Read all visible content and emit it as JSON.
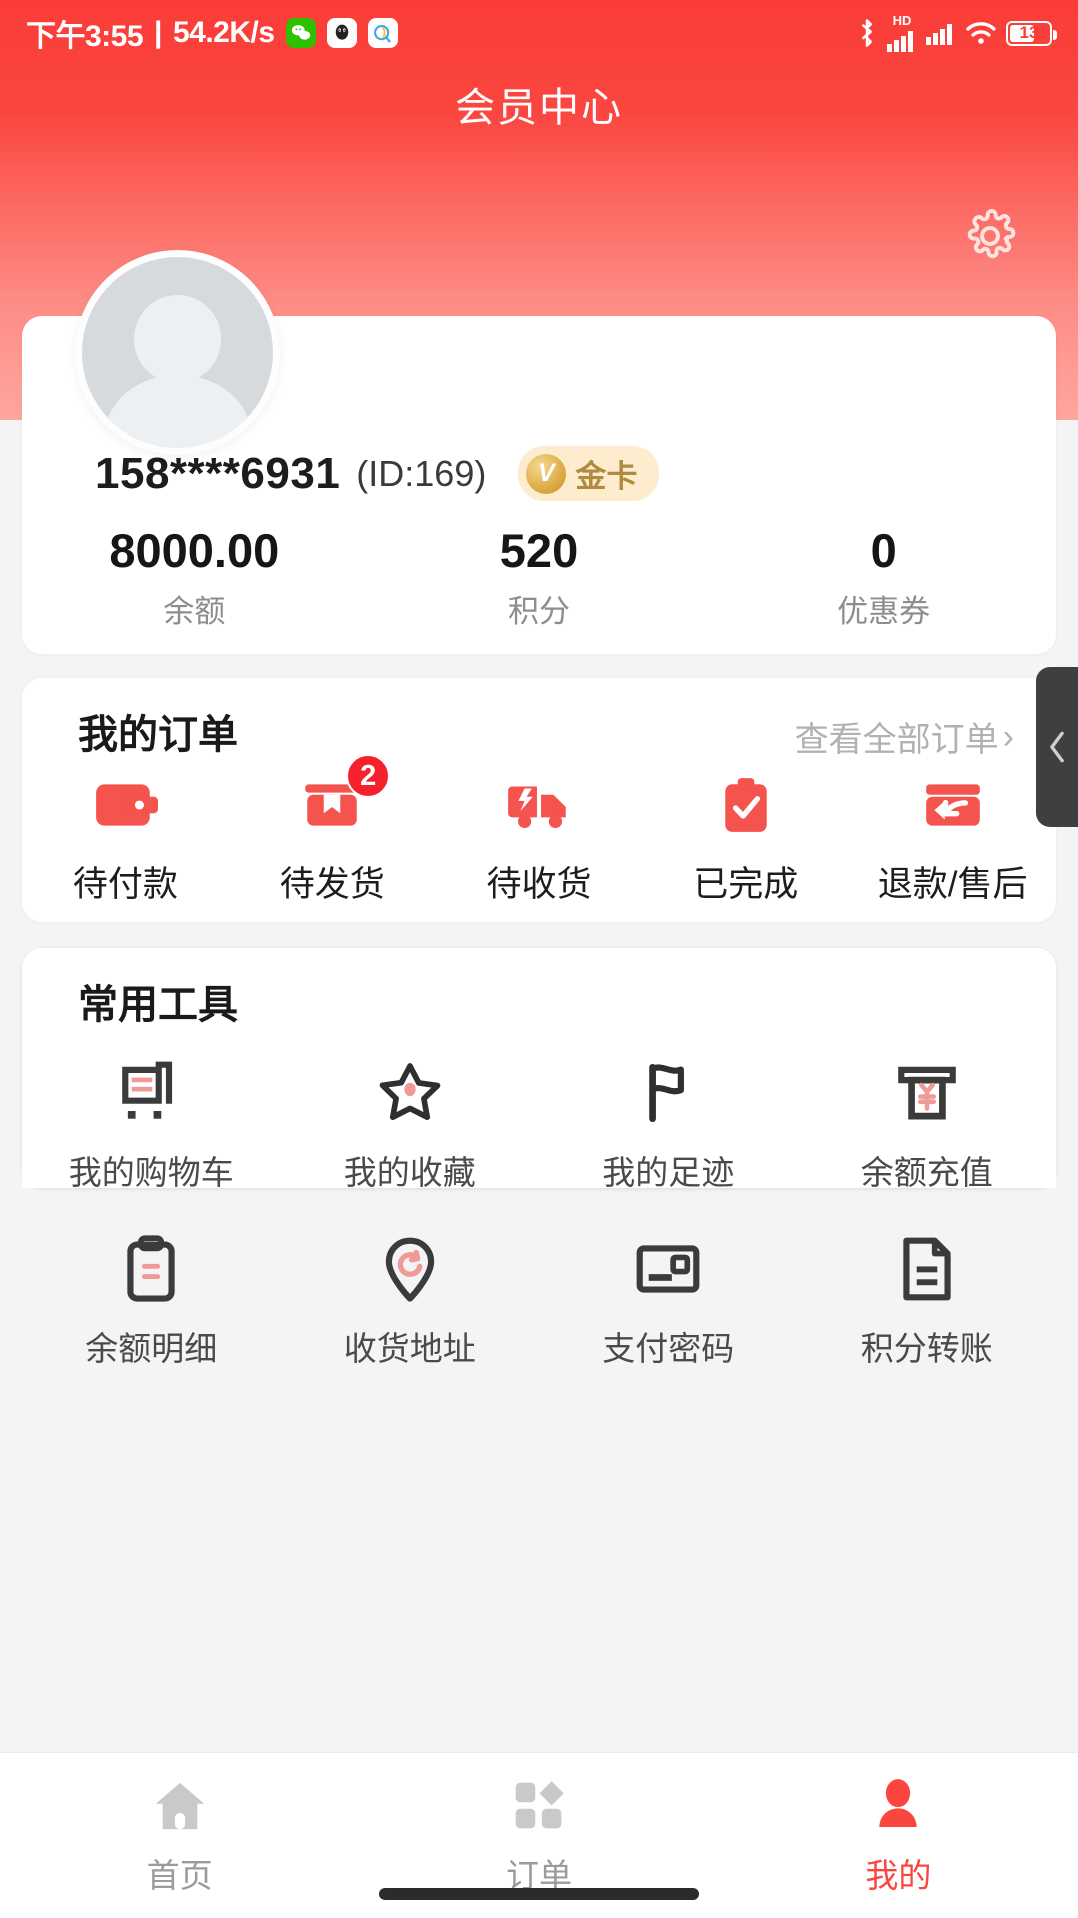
{
  "status_bar": {
    "time": "下午3:55",
    "separator": "|",
    "net_speed": "54.2K/s",
    "app_icons": [
      "wechat-icon",
      "qq-icon",
      "qq-browser-icon"
    ],
    "right_icons": [
      "bluetooth-icon",
      "hd-icon",
      "signal-1-icon",
      "signal-2-icon",
      "wifi-icon"
    ],
    "battery_level": "13",
    "hd_label": "HD"
  },
  "header": {
    "title": "会员中心",
    "settings_icon": "gear-icon",
    "bg_color": "#fb4640"
  },
  "profile": {
    "avatar_icon": "default-avatar-icon",
    "phone": "158****6931",
    "user_id": "(ID:169)",
    "vip": {
      "icon_text": "V",
      "label": "金卡",
      "bg": "#fdeccd",
      "text_color": "#b08a3e"
    },
    "stats": [
      {
        "value": "8000.00",
        "label": "余额"
      },
      {
        "value": "520",
        "label": "积分"
      },
      {
        "value": "0",
        "label": "优惠券"
      }
    ]
  },
  "orders": {
    "title": "我的订单",
    "view_all": "查看全部订单",
    "view_all_chevron": "›",
    "items": [
      {
        "label": "待付款",
        "icon": "wallet-icon",
        "badge": ""
      },
      {
        "label": "待发货",
        "icon": "package-box-icon",
        "badge": "2"
      },
      {
        "label": "待收货",
        "icon": "delivery-truck-icon",
        "badge": ""
      },
      {
        "label": "已完成",
        "icon": "clipboard-check-icon",
        "badge": ""
      },
      {
        "label": "退款/售后",
        "icon": "refund-return-icon",
        "badge": ""
      }
    ],
    "accent_color": "#f5534d"
  },
  "tools": {
    "title": "常用工具",
    "items": [
      {
        "label": "我的购物车",
        "icon": "shopping-cart-icon"
      },
      {
        "label": "我的收藏",
        "icon": "star-favorite-icon"
      },
      {
        "label": "我的足迹",
        "icon": "flag-footprint-icon"
      },
      {
        "label": "余额充值",
        "icon": "atm-recharge-icon"
      },
      {
        "label": "余额明细",
        "icon": "clipboard-detail-icon"
      },
      {
        "label": "收货地址",
        "icon": "location-pin-icon"
      },
      {
        "label": "支付密码",
        "icon": "card-password-icon"
      },
      {
        "label": "积分转账",
        "icon": "document-transfer-icon"
      }
    ]
  },
  "side_tab": {
    "icon": "chevron-left-icon"
  },
  "bottom_nav": {
    "items": [
      {
        "label": "首页",
        "icon": "home-icon",
        "active": false
      },
      {
        "label": "订单",
        "icon": "orders-grid-icon",
        "active": false
      },
      {
        "label": "我的",
        "icon": "person-icon",
        "active": true
      }
    ],
    "active_color": "#fb4640",
    "inactive_color": "#c9c9c9"
  }
}
